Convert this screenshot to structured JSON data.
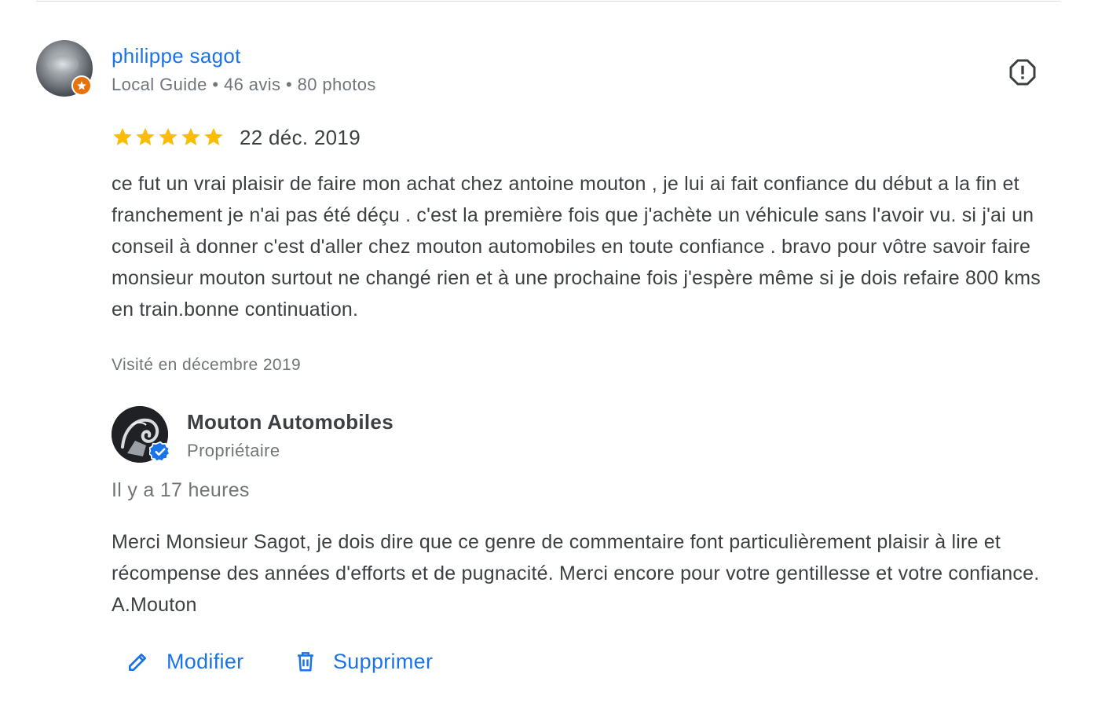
{
  "review": {
    "reviewer_name": "philippe sagot",
    "reviewer_meta": "Local Guide • 46 avis • 80 photos",
    "rating": 5,
    "rating_max": 5,
    "date": "22 déc. 2019",
    "text": "ce fut un vrai plaisir de faire mon achat chez antoine mouton , je lui ai fait confiance du début a la fin et franchement je n'ai pas été déçu . c'est la première fois que j'achète un véhicule sans l'avoir vu. si j'ai un conseil à donner c'est d'aller chez mouton automobiles en toute confiance . bravo pour vôtre savoir faire monsieur mouton surtout ne changé rien et à une prochaine fois j'espère même si je dois refaire 800 kms en train.bonne continuation.",
    "visited": "Visité en décembre 2019"
  },
  "reply": {
    "owner_name": "Mouton Automobiles",
    "owner_role": "Propriétaire",
    "time": "Il y a 17 heures",
    "text": "Merci Monsieur Sagot, je dois dire que ce genre de commentaire font particulièrement plaisir à lire et récompense des années d'efforts et de pugnacité. Merci encore pour votre gentillesse et votre confiance. A.Mouton"
  },
  "actions": {
    "edit_label": "Modifier",
    "delete_label": "Supprimer"
  },
  "colors": {
    "link_blue": "#1a73e8",
    "star_yellow": "#fbbc04",
    "local_guide_orange": "#e8710a",
    "text_primary": "#3c4043",
    "text_secondary": "#70757a"
  },
  "icons": {
    "report": "report-icon",
    "star": "star-icon",
    "local_guide_badge": "local-guide-badge-icon",
    "verified": "verified-check-icon",
    "edit": "pencil-icon",
    "delete": "trash-icon"
  }
}
